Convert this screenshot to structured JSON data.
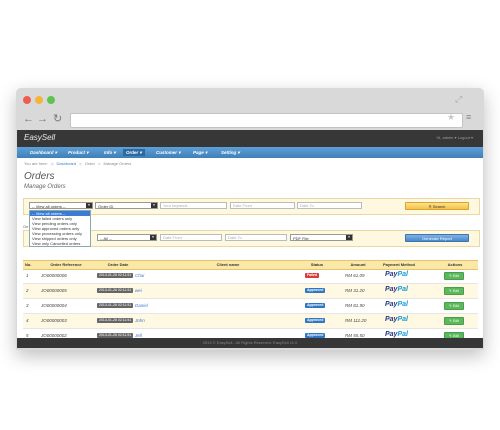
{
  "app": {
    "brand": "EasySell",
    "topbar_right": "Hi, admin ▾   Logout ▾"
  },
  "menu": [
    "Dashboard ▾",
    "Product ▾",
    "Info ▾",
    "Order ▾",
    "Customer ▾",
    "Page ▾",
    "Setting ▾"
  ],
  "breadcrumb": {
    "prefix": "You are here:",
    "items": [
      "Dashboard",
      ">",
      "Order",
      ">",
      "Manage Orders"
    ]
  },
  "page": {
    "title": "Orders",
    "subtitle": "Manage Orders"
  },
  "filters": {
    "order_filter_value": "-- View all orders --",
    "order_filter_options": [
      "-- View all orders --",
      "View failed orders only",
      "View pending orders only",
      "View approved orders only",
      "View processing orders only",
      "View shipped orders only",
      "View only Cancelled orders"
    ],
    "search_by_value": "Order ID",
    "keyword_placeholder": "Your keyword...",
    "date_from_placeholder": "Date From",
    "date_to_placeholder": "Date To",
    "search_button": "Search"
  },
  "export": {
    "prefix": "Ge",
    "all_value": "-- All --",
    "date_from_placeholder": "Date From",
    "date_to_placeholder": "Date To",
    "format_value": "PDF File",
    "generate_button": "Generate Report"
  },
  "table": {
    "headers": [
      "No.",
      "Order Reference",
      "Order Date",
      "Client name",
      "Status",
      "Amount",
      "Payment Method",
      "Actions"
    ],
    "rows": [
      {
        "no": "1",
        "ref": "JO00000006",
        "date": "2013-01-26 02:11:51",
        "client": "Chai",
        "status": "Failed",
        "amount": "RM 61.09",
        "payment": "PayPal",
        "action": "Edit"
      },
      {
        "no": "2",
        "ref": "JO00000005",
        "date": "2013-01-26 02:11:51",
        "client": "wei",
        "status": "Approved",
        "amount": "RM 31.20",
        "payment": "PayPal",
        "action": "Edit"
      },
      {
        "no": "3",
        "ref": "JO00000004",
        "date": "2013-01-26 02:11:51",
        "client": "Daniel",
        "status": "Approved",
        "amount": "RM 81.90",
        "payment": "PayPal",
        "action": "Edit"
      },
      {
        "no": "4",
        "ref": "JO00000003",
        "date": "2013-01-26 02:11:51",
        "client": "John",
        "status": "Approved",
        "amount": "RM 111.20",
        "payment": "PayPal",
        "action": "Edit"
      },
      {
        "no": "5",
        "ref": "JO00000002",
        "date": "2013-01-26 02:11:51",
        "client": "Jell",
        "status": "Approved",
        "amount": "RM 55.50",
        "payment": "PayPal",
        "action": "Edit"
      }
    ]
  },
  "footer": "2013 © EasySell - All Rights Reserved. EasySell v1.0",
  "colors": {
    "menubar": "#4a8cc8",
    "header_row": "#fbe7a6",
    "failed": "#d93b3b",
    "approved": "#2f77c2",
    "edit": "#5cb85c"
  }
}
